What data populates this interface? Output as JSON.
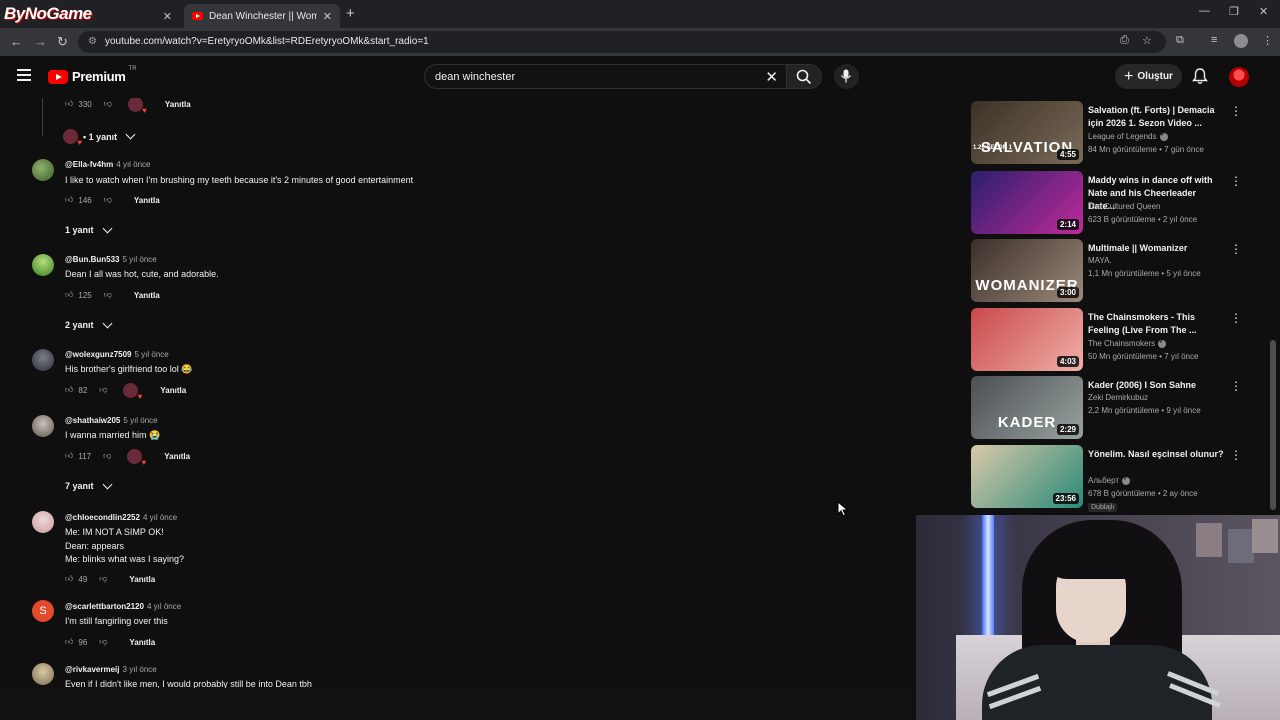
{
  "browser": {
    "brand_logo": "ByNoGame",
    "active_tab_title": "Dean Winchester || Womanizer",
    "new_tab_symbol": "+",
    "url": "youtube.com/watch?v=EretyryoOMk&list=RDEretyryoOMk&start_radio=1"
  },
  "youtube": {
    "brand": "Premium",
    "country_code": "TR",
    "search_query": "dean winchester",
    "create_label": "Oluştur"
  },
  "comments": [
    {
      "likes": "330",
      "reply_label": "Yanıtla",
      "replies_label": "• 1 yanıt"
    },
    {
      "author": "@Ella-fv4hm",
      "time": "4 yıl önce",
      "text": "I like to watch when I'm brushing my teeth because it's 2 minutes of good entertainment",
      "likes": "146",
      "reply_label": "Yanıtla",
      "replies_label": "1 yanıt"
    },
    {
      "author": "@Bun.Bun533",
      "time": "5 yıl önce",
      "text": "Dean I all was hot, cute, and adorable.",
      "likes": "125",
      "reply_label": "Yanıtla",
      "replies_label": "2 yanıt"
    },
    {
      "author": "@wolexgunz7509",
      "time": "5 yıl önce",
      "text": "His brother's girlfriend too lol 😂",
      "likes": "82",
      "reply_label": "Yanıtla"
    },
    {
      "author": "@shathaiw205",
      "time": "5 yıl önce",
      "text": "I wanna married him 😭",
      "likes": "117",
      "reply_label": "Yanıtla",
      "replies_label": "7 yanıt"
    },
    {
      "author": "@chloecondlin2252",
      "time": "4 yıl önce",
      "lines": [
        "Me: IM NOT A SIMP OK!",
        "Dean: appears",
        "Me: blinks what was I saying?"
      ],
      "likes": "49",
      "reply_label": "Yanıtla"
    },
    {
      "author": "@scarlettbarton2120",
      "time": "4 yıl önce",
      "avatar_letter": "S",
      "text": "I'm still fangirling over this",
      "likes": "96",
      "reply_label": "Yanıtla"
    },
    {
      "author": "@rivkavermeij",
      "time": "3 yıl önce",
      "text": "Even if I didn't like men, I would probably still be into Dean tbh"
    }
  ],
  "sidebar": [
    {
      "title": "Salvation (ft. Forts) | Demacia için 2026 1. Sezon Video ...",
      "channel": "League of Legends",
      "verified": true,
      "meta": "84 Mn görüntüleme • 7 gün önce",
      "duration": "4:55",
      "overlay": "SALVATION",
      "overlay_small": "1.26 SEZON 1",
      "thumb_colors": [
        "#3b3226",
        "#7a6a58"
      ]
    },
    {
      "title": "Maddy wins in dance off with Nate and his Cheerleader Date...",
      "channel": "The Cultured Queen",
      "meta": "623 B görüntüleme • 2 yıl önce",
      "duration": "2:14",
      "thumb_colors": [
        "#2a1f6b",
        "#c02a9a"
      ]
    },
    {
      "title": "Multimale || Womanizer",
      "channel": "MAYA.",
      "meta": "1,1 Mn görüntüleme • 5 yıl önce",
      "duration": "3:00",
      "overlay": "WOMANIZER",
      "thumb_colors": [
        "#3a2f2a",
        "#9c8a7a"
      ]
    },
    {
      "title": "The Chainsmokers - This Feeling (Live From The ...",
      "channel": "The Chainsmokers",
      "verified": true,
      "meta": "50 Mn görüntüleme • 7 yıl önce",
      "duration": "4:03",
      "thumb_colors": [
        "#c9494a",
        "#f0b0a8"
      ]
    },
    {
      "title": "Kader (2006) I Son Sahne",
      "channel": "Zeki Demirkubuz",
      "meta": "2,2 Mn görüntüleme • 9 yıl önce",
      "duration": "2:29",
      "overlay": "KADER",
      "thumb_colors": [
        "#4a4f52",
        "#9aa2a0"
      ]
    },
    {
      "title": "Yönelim. Nasıl eşcinsel olunur?",
      "channel": "Альберт",
      "verified": true,
      "meta": "678 B görüntüleme • 2 ay önce",
      "badge": "Dublajlı",
      "duration": "23:56",
      "thumb_colors": [
        "#d9c9a8",
        "#2a8a7a"
      ]
    }
  ],
  "colors": {
    "accent": "#ff0000",
    "background": "#0f0f0f",
    "text_secondary": "#aaaaaa"
  }
}
